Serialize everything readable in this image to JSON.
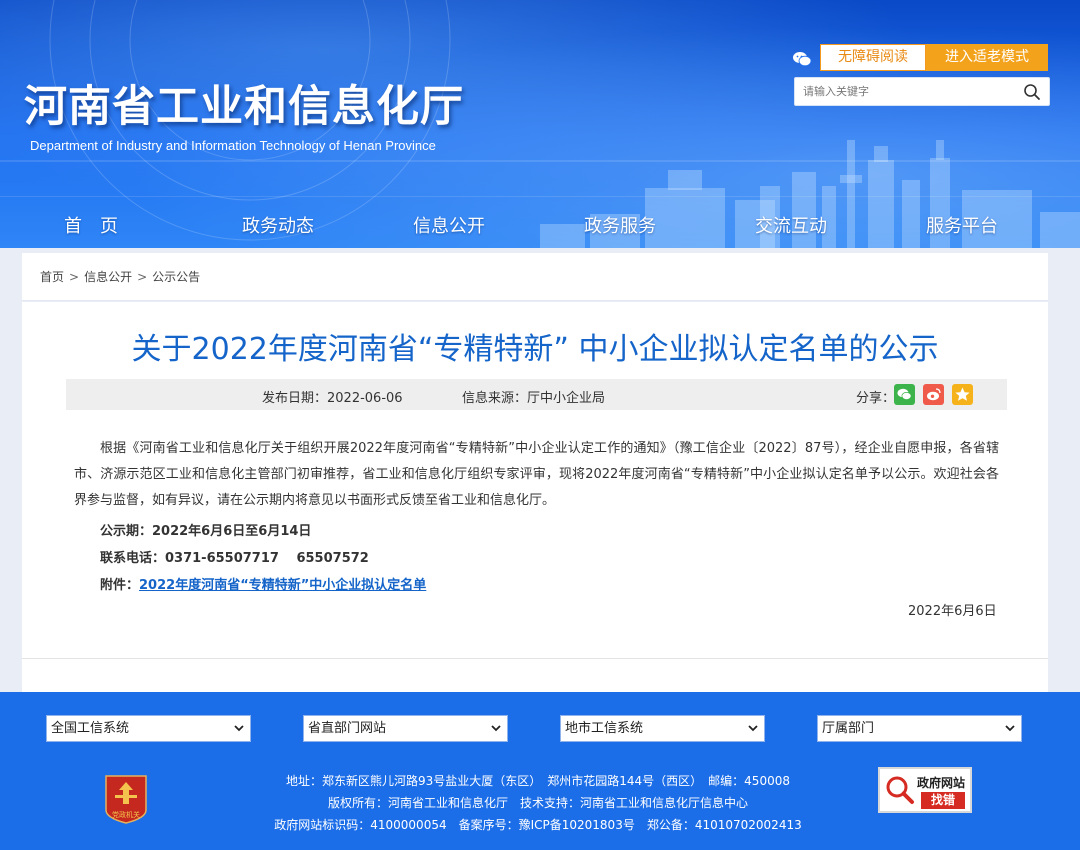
{
  "header": {
    "title": "河南省工业和信息化厅",
    "subtitle": "Department of Industry and Information Technology of Henan Province",
    "accessibility_label": "无障碍阅读",
    "elder_mode_label": "进入适老模式",
    "search_placeholder": "请输入关键字"
  },
  "nav": {
    "items": [
      {
        "label": "首　页"
      },
      {
        "label": "政务动态"
      },
      {
        "label": "信息公开"
      },
      {
        "label": "政务服务"
      },
      {
        "label": "交流互动"
      },
      {
        "label": "服务平台"
      }
    ]
  },
  "breadcrumb": {
    "items": [
      "首页",
      "信息公开",
      "公示公告"
    ],
    "separator": ">"
  },
  "article": {
    "title": "关于2022年度河南省“专精特新” 中小企业拟认定名单的公示",
    "publish_date": "发布日期：2022-06-06",
    "source": "信息来源：厅中小企业局",
    "share_label": "分享：",
    "paragraph": "根据《河南省工业和信息化厅关于组织开展2022年度河南省“专精特新”中小企业认定工作的通知》（豫工信企业〔2022〕87号），经企业自愿申报，各省辖市、济源示范区工业和信息化主管部门初审推荐，省工业和信息化厅组织专家评审，现将2022年度河南省“专精特新”中小企业拟认定名单予以公示。欢迎社会各界参与监督，如有异议，请在公示期内将意见以书面形式反馈至省工业和信息化厅。",
    "period": "公示期：2022年6月6日至6月14日",
    "phone": "联系电话：0371-65507717　 65507572",
    "attachment_label": "附件：",
    "attachment_link": "2022年度河南省“专精特新”中小企业拟认定名单",
    "sign_date": "2022年6月6日"
  },
  "footer": {
    "selects": [
      "全国工信系统",
      "省直部门网站",
      "地市工信系统",
      "厅属部门"
    ],
    "badge_text": "党政机关",
    "address": "地址：郑东新区熊儿河路93号盐业大厦（东区）　郑州市花园路144号（西区）　邮编：450008",
    "copyright": "版权所有：河南省工业和信息化厅　技术支持：河南省工业和信息化厅信息中心",
    "ids": "政府网站标识码：4100000054　备案序号：豫ICP备10201803号　郑公备：41010702002413",
    "error_top": "政府网站",
    "error_btn": "找错"
  },
  "colors": {
    "header_blue": "#1f6ff0",
    "title_blue": "#1464c9",
    "orange": "#f3a21c",
    "footer_blue": "#1c6ee8"
  }
}
